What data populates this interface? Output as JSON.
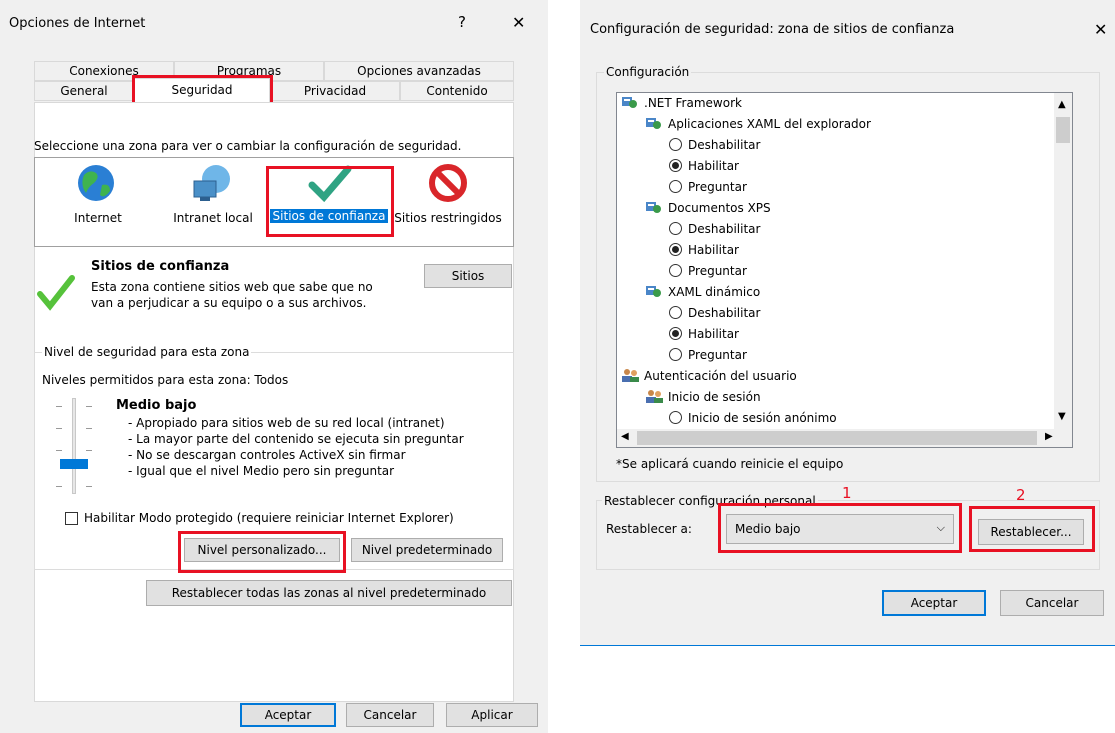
{
  "left": {
    "title": "Opciones de Internet",
    "help_glyph": "?",
    "close_glyph": "✕",
    "tabs_back": [
      "Conexiones",
      "Programas",
      "Opciones avanzadas"
    ],
    "tabs_front": [
      "General",
      "Seguridad",
      "Privacidad",
      "Contenido"
    ],
    "zone_prompt": "Seleccione una zona para ver o cambiar la configuración de seguridad.",
    "zones": [
      "Internet",
      "Intranet local",
      "Sitios de confianza",
      "Sitios restringidos"
    ],
    "zone_title": "Sitios de confianza",
    "zone_desc_1": "Esta zona contiene sitios web que sabe que no",
    "zone_desc_2": "van a perjudicar a su equipo o a sus archivos.",
    "sites_button": "Sitios",
    "level_group": "Nivel de seguridad para esta zona",
    "allowed_levels": "Niveles permitidos para esta zona: Todos",
    "slider_level": 0.25,
    "level_name": "Medio bajo",
    "level_lines": [
      "- Apropiado para sitios web de su red local (intranet)",
      "- La mayor parte del contenido se ejecuta sin preguntar",
      "- No se descargan controles ActiveX sin firmar",
      "- Igual que el nivel Medio pero sin preguntar"
    ],
    "protected_mode": "Habilitar Modo protegido (requiere reiniciar Internet Explorer)",
    "custom_level": "Nivel personalizado...",
    "default_level": "Nivel predeterminado",
    "reset_all": "Restablecer todas las zonas al nivel predeterminado",
    "ok": "Aceptar",
    "cancel": "Cancelar",
    "apply": "Aplicar"
  },
  "right": {
    "title": "Configuración de seguridad: zona de sitios de confianza",
    "close_glyph": "✕",
    "settings_group": "Configuración",
    "tree": [
      {
        "kind": "icon",
        "text": ".NET Framework"
      },
      {
        "kind": "icon",
        "text": "Aplicaciones XAML del explorador"
      },
      {
        "kind": "radio",
        "text": "Deshabilitar",
        "checked": false
      },
      {
        "kind": "radio",
        "text": "Habilitar",
        "checked": true
      },
      {
        "kind": "radio",
        "text": "Preguntar",
        "checked": false
      },
      {
        "kind": "icon",
        "text": "Documentos XPS"
      },
      {
        "kind": "radio",
        "text": "Deshabilitar",
        "checked": false
      },
      {
        "kind": "radio",
        "text": "Habilitar",
        "checked": true
      },
      {
        "kind": "radio",
        "text": "Preguntar",
        "checked": false
      },
      {
        "kind": "icon",
        "text": "XAML dinámico"
      },
      {
        "kind": "radio",
        "text": "Deshabilitar",
        "checked": false
      },
      {
        "kind": "radio",
        "text": "Habilitar",
        "checked": true
      },
      {
        "kind": "radio",
        "text": "Preguntar",
        "checked": false
      },
      {
        "kind": "user",
        "text": "Autenticación del usuario"
      },
      {
        "kind": "user",
        "text": "Inicio de sesión"
      },
      {
        "kind": "radio",
        "text": "Inicio de sesión anónimo",
        "checked": false
      }
    ],
    "restart_note": "*Se aplicará cuando reinicie el equipo",
    "reset_group": "Restablecer configuración personal",
    "reset_to_label": "Restablecer a:",
    "reset_value": "Medio bajo",
    "reset_button": "Restablecer...",
    "ok": "Aceptar",
    "cancel": "Cancelar",
    "annotation_1": "1",
    "annotation_2": "2"
  },
  "colors": {
    "accent": "#0078d7",
    "highlight": "#e81123",
    "selected_bg": "#0078d7"
  }
}
